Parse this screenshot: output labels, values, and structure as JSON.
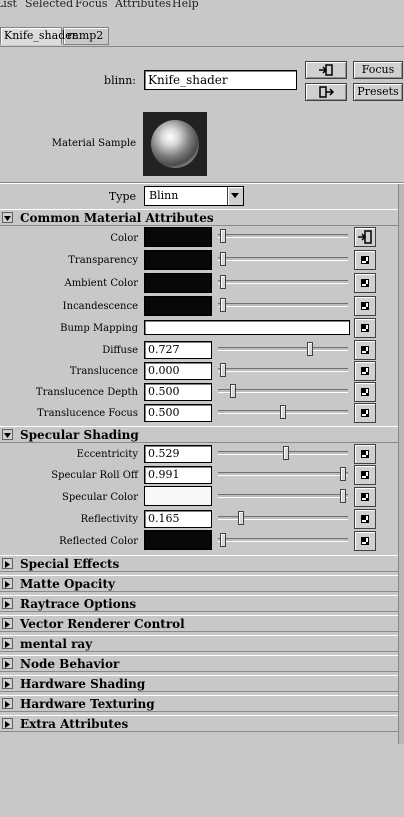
{
  "menu": [
    "List",
    "Selected",
    "Focus",
    "Attributes",
    "Help"
  ],
  "tabs": [
    {
      "label": "Knife_shader",
      "active": true
    },
    {
      "label": "ramp2",
      "active": false
    }
  ],
  "header": {
    "node_type_label": "blinn:",
    "node_name": "Knife_shader",
    "focus_label": "Focus",
    "presets_label": "Presets",
    "material_sample_label": "Material Sample"
  },
  "type_row": {
    "label": "Type",
    "value": "Blinn"
  },
  "common": {
    "title": "Common Material Attributes",
    "color_label": "Color",
    "transparency_label": "Transparency",
    "ambient_label": "Ambient Color",
    "incandescence_label": "Incandescence",
    "bump_label": "Bump Mapping",
    "diffuse_label": "Diffuse",
    "diffuse_value": "0.727",
    "translucence_label": "Translucence",
    "translucence_value": "0.000",
    "translucence_depth_label": "Translucence Depth",
    "translucence_depth_value": "0.500",
    "translucence_focus_label": "Translucence Focus",
    "translucence_focus_value": "0.500"
  },
  "specular": {
    "title": "Specular Shading",
    "eccentricity_label": "Eccentricity",
    "eccentricity_value": "0.529",
    "rolloff_label": "Specular Roll Off",
    "rolloff_value": "0.991",
    "color_label": "Specular Color",
    "reflectivity_label": "Reflectivity",
    "reflectivity_value": "0.165",
    "reflected_label": "Reflected Color"
  },
  "collapsed_sections": [
    "Special Effects",
    "Matte Opacity",
    "Raytrace Options",
    "Vector Renderer Control",
    "mental ray",
    "Node Behavior",
    "Hardware Shading",
    "Hardware Texturing",
    "Extra Attributes"
  ],
  "colors": {
    "swatch_black": "#080808",
    "swatch_white": "#f8f8f8",
    "panel": "#c8c8c8"
  }
}
